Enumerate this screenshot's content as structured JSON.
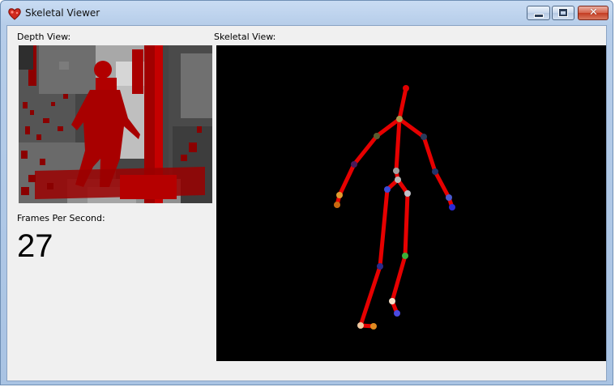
{
  "window": {
    "title": "Skeletal Viewer",
    "app_icon": "kinect-heart-icon",
    "controls": {
      "minimize": "minimize-icon",
      "maximize": "maximize-icon",
      "close": "close-icon",
      "close_glyph": "✕"
    }
  },
  "depth_view": {
    "label": "Depth View:"
  },
  "skeletal_view": {
    "label": "Skeletal View:",
    "bone_color": "#e60000",
    "background_color": "#000000"
  },
  "fps": {
    "label": "Frames Per Second:",
    "value": "27"
  }
}
